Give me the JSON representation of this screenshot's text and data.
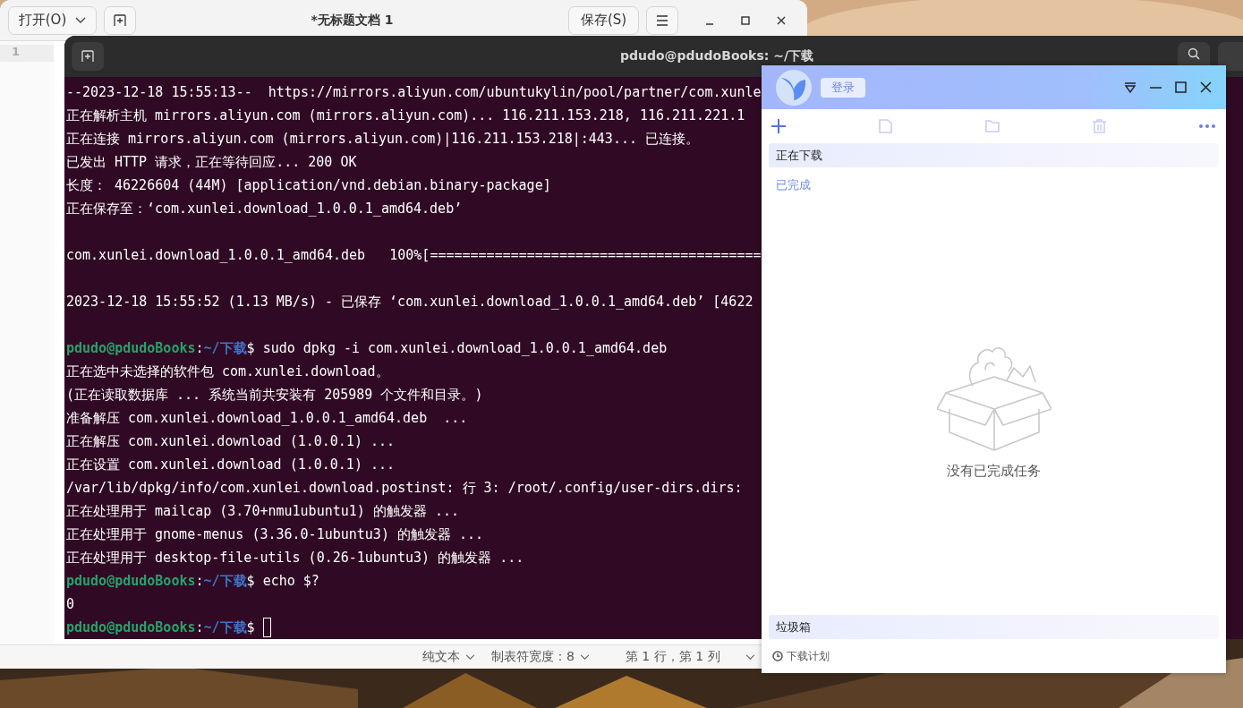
{
  "editor": {
    "open_button": "打开(O)",
    "title": "*无标题文档 1",
    "save_button": "保存(S)",
    "line_numbers": [
      "1"
    ],
    "status_bar": [
      {
        "kind": "dropdown",
        "label": "纯文本"
      },
      {
        "kind": "dropdown",
        "label": "制表符宽度：8"
      },
      {
        "kind": "text",
        "label": "第 1 行，第 1 列"
      }
    ]
  },
  "terminal": {
    "title": "pdudo@pdudoBooks: ~/下载",
    "lines": [
      {
        "kind": "output",
        "text": "--2023-12-18 15:55:13--  https://mirrors.aliyun.com/ubuntukylin/pool/partner/com.xunle"
      },
      {
        "kind": "output",
        "text": "正在解析主机 mirrors.aliyun.com (mirrors.aliyun.com)... 116.211.153.218, 116.211.221.1"
      },
      {
        "kind": "output",
        "text": "正在连接 mirrors.aliyun.com (mirrors.aliyun.com)|116.211.153.218|:443... 已连接。"
      },
      {
        "kind": "output",
        "text": "已发出 HTTP 请求，正在等待回应... 200 OK"
      },
      {
        "kind": "output",
        "text": "长度： 46226604 (44M) [application/vnd.debian.binary-package]"
      },
      {
        "kind": "output",
        "text": "正在保存至：‘com.xunlei.download_1.0.0.1_amd64.deb’"
      },
      {
        "kind": "blank"
      },
      {
        "kind": "output",
        "text": "com.xunlei.download_1.0.0.1_amd64.deb   100%[========================================="
      },
      {
        "kind": "blank"
      },
      {
        "kind": "output",
        "text": "2023-12-18 15:55:52 (1.13 MB/s) - 已保存 ‘com.xunlei.download_1.0.0.1_amd64.deb’ [4622"
      },
      {
        "kind": "blank"
      },
      {
        "kind": "prompt",
        "user": "pdudo@pdudoBooks",
        "sep": ":",
        "path": "~/下载",
        "command": "$ sudo dpkg -i com.xunlei.download_1.0.0.1_amd64.deb",
        "cursor": false
      },
      {
        "kind": "output",
        "text": "正在选中未选择的软件包 com.xunlei.download。"
      },
      {
        "kind": "output",
        "text": "(正在读取数据库 ... 系统当前共安装有 205989 个文件和目录。)"
      },
      {
        "kind": "output",
        "text": "准备解压 com.xunlei.download_1.0.0.1_amd64.deb  ..."
      },
      {
        "kind": "output",
        "text": "正在解压 com.xunlei.download (1.0.0.1) ..."
      },
      {
        "kind": "output",
        "text": "正在设置 com.xunlei.download (1.0.0.1) ..."
      },
      {
        "kind": "output",
        "text": "/var/lib/dpkg/info/com.xunlei.download.postinst: 行 3: /root/.config/user-dirs.dirs:"
      },
      {
        "kind": "output",
        "text": "正在处理用于 mailcap (3.70+nmu1ubuntu1) 的触发器 ..."
      },
      {
        "kind": "output",
        "text": "正在处理用于 gnome-menus (3.36.0-1ubuntu3) 的触发器 ..."
      },
      {
        "kind": "output",
        "text": "正在处理用于 desktop-file-utils (0.26-1ubuntu3) 的触发器 ..."
      },
      {
        "kind": "prompt",
        "user": "pdudo@pdudoBooks",
        "sep": ":",
        "path": "~/下载",
        "command": "$ echo $?",
        "cursor": false
      },
      {
        "kind": "output",
        "text": "0"
      },
      {
        "kind": "prompt",
        "user": "pdudo@pdudoBooks",
        "sep": ":",
        "path": "~/下载",
        "command": "$",
        "cursor": true
      }
    ]
  },
  "downloader": {
    "login_button": "登录",
    "nav": [
      {
        "kind": "header",
        "label": "正在下载"
      },
      {
        "kind": "item",
        "label": "已完成",
        "selected": true
      }
    ],
    "empty_message": "没有已完成任务",
    "trash": "垃圾箱",
    "schedule_link": "下载计划"
  }
}
